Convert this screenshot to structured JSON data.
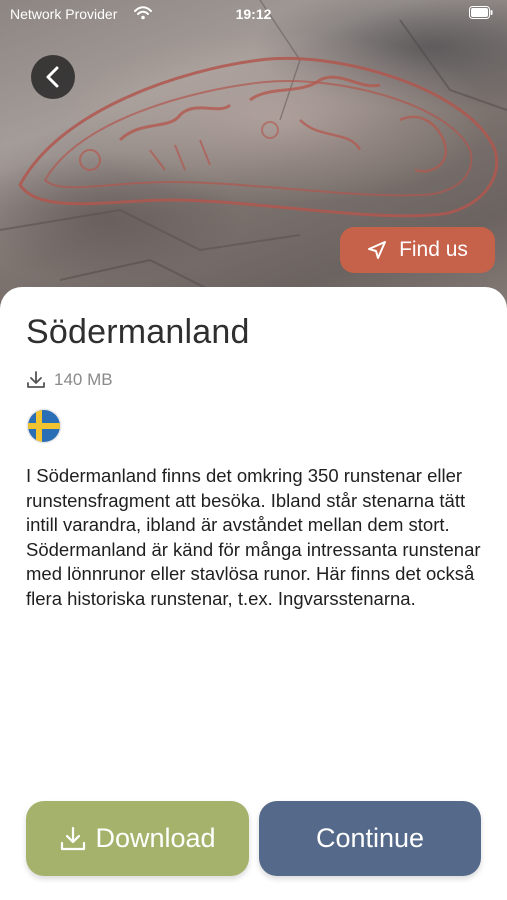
{
  "status_bar": {
    "provider": "Network Provider",
    "time": "19:12"
  },
  "hero": {
    "image": "runestone-carving",
    "find_us_label": "Find us",
    "find_us_icon": "navigation-arrow-icon",
    "back_icon": "chevron-left-icon"
  },
  "region": {
    "title": "Södermanland",
    "size": "140 MB",
    "size_icon": "download-icon",
    "flag": "sweden-flag-icon",
    "description": "I Södermanland finns det omkring 350 runstenar eller runstensfragment att besöka. Ibland står stenarna tätt intill varandra, ibland är avståndet mellan dem stort. Södermanland är känd för många intressanta runstenar med lönnrunor eller stavlösa runor. Här finns det också flera historiska runstenar, t.ex. Ingvarsstenarna."
  },
  "actions": {
    "download_label": "Download",
    "continue_label": "Continue"
  },
  "colors": {
    "find_us": "#c6614a",
    "download": "#a5b26b",
    "continue": "#55698a",
    "flag_blue": "#2a6fb5",
    "flag_yellow": "#f4c430"
  }
}
